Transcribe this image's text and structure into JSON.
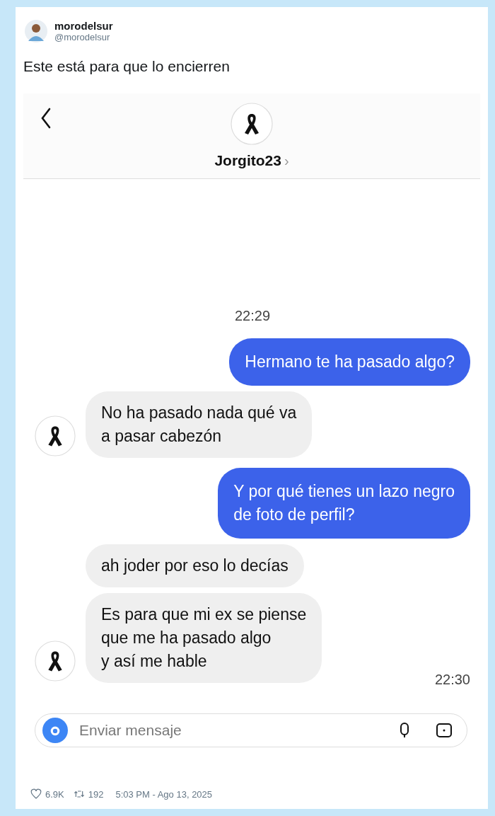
{
  "tweet": {
    "author": "morodelsur",
    "handle": "@morodelsur",
    "text": "Este está para que lo encierren"
  },
  "chat": {
    "contact": "Jorgito23",
    "chevron": "›",
    "items": [
      {
        "kind": "timestamp",
        "text": "22:29"
      },
      {
        "kind": "sent",
        "text": "Hermano te ha pasado algo?"
      },
      {
        "kind": "received",
        "avatar": true,
        "text": "No ha pasado nada qué va\na pasar cabezón"
      },
      {
        "kind": "sent",
        "text": "Y por qué tienes un lazo negro\nde foto de perfil?"
      },
      {
        "kind": "received",
        "avatar": false,
        "text": "ah joder por eso lo decías"
      },
      {
        "kind": "received",
        "avatar": true,
        "text": "Es para que mi ex se piense\nque me ha pasado algo\ny así me hable"
      },
      {
        "kind": "sidetime",
        "text": "22:30"
      }
    ],
    "input": {
      "placeholder": "Enviar mensaje"
    }
  },
  "footer": {
    "likes": "6.9K",
    "retweets": "192",
    "date": "5:03 PM - Ago 13, 2025"
  }
}
